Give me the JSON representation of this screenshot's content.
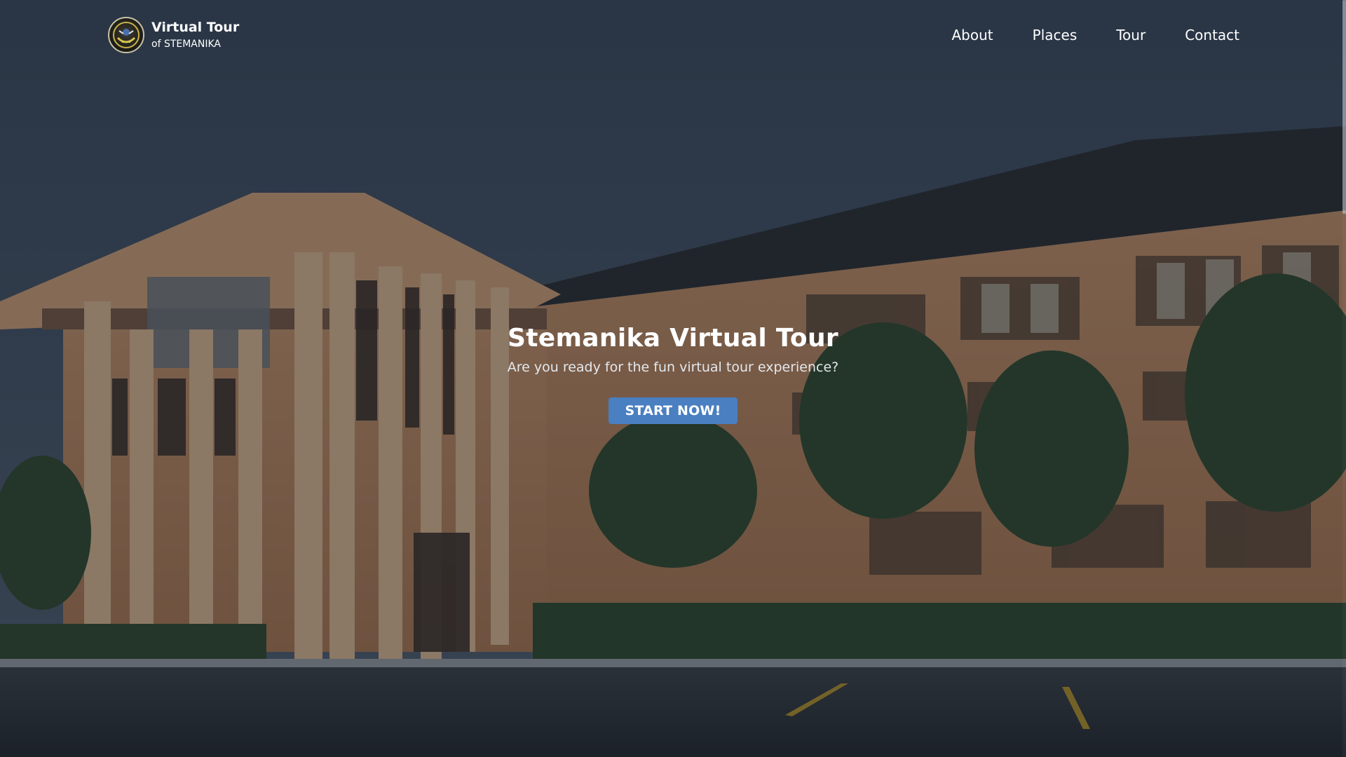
{
  "header": {
    "brand_title": "Virtual Tour",
    "brand_subtitle": "of STEMANIKA",
    "nav": [
      {
        "label": "About"
      },
      {
        "label": "Places"
      },
      {
        "label": "Tour"
      },
      {
        "label": "Contact"
      }
    ]
  },
  "hero": {
    "title": "Stemanika Virtual Tour",
    "subtitle": "Are you ready for the fun virtual tour experience?",
    "cta_label": "START NOW!"
  },
  "colors": {
    "accent": "#4a7fc1",
    "text": "#ffffff",
    "overlay": "#141a24"
  },
  "icons": {
    "logo": "school-emblem-icon"
  }
}
